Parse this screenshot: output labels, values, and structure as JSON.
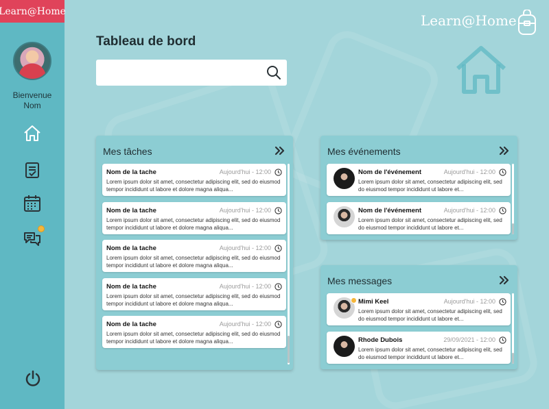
{
  "brand": {
    "badge": "Learn@Home",
    "logo": "Learn@Home"
  },
  "user": {
    "welcome": "Bienvenue",
    "name": "Nom"
  },
  "nav": [
    {
      "icon": "home-icon"
    },
    {
      "icon": "tasks-icon"
    },
    {
      "icon": "calendar-icon"
    },
    {
      "icon": "messages-icon",
      "notification": true
    }
  ],
  "page": {
    "title": "Tableau de bord"
  },
  "search": {
    "placeholder": "",
    "value": ""
  },
  "colors": {
    "sidebar": "#5fb8c3",
    "badge": "#e0435a",
    "panel": "#8ccdd3",
    "notification": "#f5b63a",
    "background": "#a3d5da"
  },
  "tasks": {
    "title": "Mes tâches",
    "items": [
      {
        "title": "Nom de la tache",
        "date": "Aujourd'hui - 12:00",
        "body": "Lorem ipsum dolor sit amet, consectetur adipiscing elit, sed do eiusmod tempor incididunt ut labore et dolore magna aliqua..."
      },
      {
        "title": "Nom de la tache",
        "date": "Aujourd'hui - 12:00",
        "body": "Lorem ipsum dolor sit amet, consectetur adipiscing elit, sed do eiusmod tempor incididunt ut labore et dolore magna aliqua..."
      },
      {
        "title": "Nom de la tache",
        "date": "Aujourd'hui - 12:00",
        "body": "Lorem ipsum dolor sit amet, consectetur adipiscing elit, sed do eiusmod tempor incididunt ut labore et dolore magna aliqua..."
      },
      {
        "title": "Nom de la tache",
        "date": "Aujourd'hui - 12:00",
        "body": "Lorem ipsum dolor sit amet, consectetur adipiscing elit, sed do eiusmod tempor incididunt ut labore et dolore magna aliqua..."
      },
      {
        "title": "Nom de la tache",
        "date": "Aujourd'hui - 12:00",
        "body": "Lorem ipsum dolor sit amet, consectetur adipiscing elit, sed do eiusmod tempor incididunt ut labore et dolore magna aliqua..."
      }
    ]
  },
  "events": {
    "title": "Mes événements",
    "items": [
      {
        "title": "Nom de l'événement",
        "date": "Aujourd'hui - 12:00",
        "body": "Lorem ipsum dolor sit amet, consectetur adipiscing elit, sed do eiusmod tempor incididunt ut labore et..."
      },
      {
        "title": "Nom de l'événement",
        "date": "Aujourd'hui - 12:00",
        "body": "Lorem ipsum dolor sit amet, consectetur adipiscing elit, sed do eiusmod tempor incididunt ut labore et..."
      }
    ]
  },
  "messages": {
    "title": "Mes messages",
    "items": [
      {
        "title": "Mimi Keel",
        "date": "Aujourd'hui - 12:00",
        "body": "Lorem ipsum dolor sit amet, consectetur adipiscing elit, sed do eiusmod tempor incididunt ut labore et..."
      },
      {
        "title": "Rhode Dubois",
        "date": "29/09/2021 - 12:00",
        "body": "Lorem ipsum dolor sit amet, consectetur adipiscing elit, sed do eiusmod tempor incididunt ut labore et..."
      }
    ]
  }
}
